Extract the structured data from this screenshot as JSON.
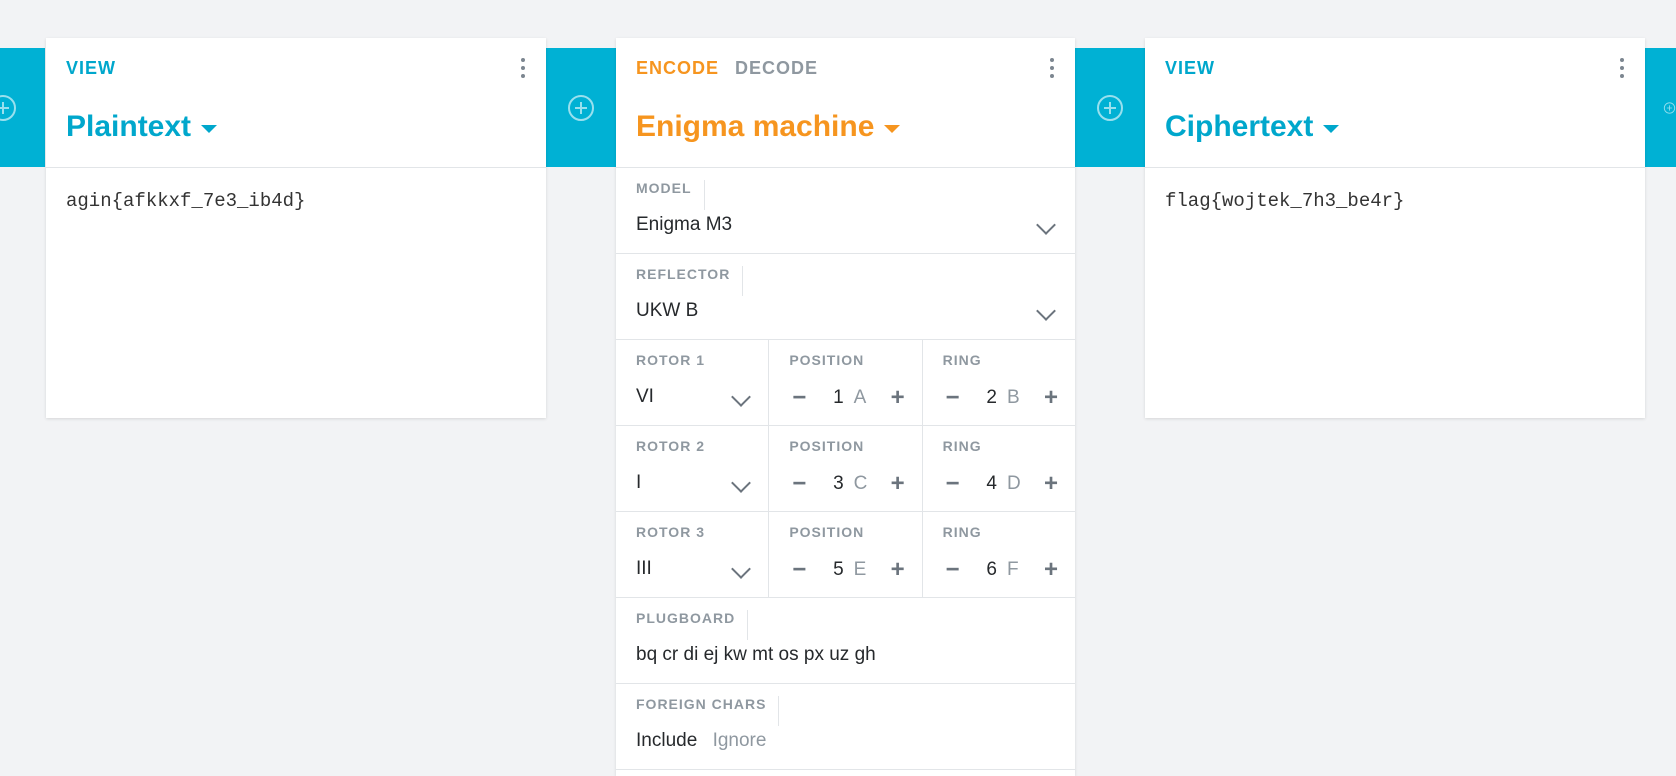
{
  "left_brick": {
    "tab": "VIEW",
    "title": "Plaintext",
    "content": "agin{afkkxf_7e3_ib4d}"
  },
  "enigma_brick": {
    "tabs": [
      "ENCODE",
      "DECODE"
    ],
    "title": "Enigma machine",
    "model": {
      "label": "MODEL",
      "value": "Enigma M3"
    },
    "reflector": {
      "label": "REFLECTOR",
      "value": "UKW B"
    },
    "rotors": [
      {
        "label": "ROTOR 1",
        "value": "VI",
        "position_label": "POSITION",
        "position": "1",
        "position_letter": "A",
        "ring_label": "RING",
        "ring": "2",
        "ring_letter": "B"
      },
      {
        "label": "ROTOR 2",
        "value": "I",
        "position_label": "POSITION",
        "position": "3",
        "position_letter": "C",
        "ring_label": "RING",
        "ring": "4",
        "ring_letter": "D"
      },
      {
        "label": "ROTOR 3",
        "value": "III",
        "position_label": "POSITION",
        "position": "5",
        "position_letter": "E",
        "ring_label": "RING",
        "ring": "6",
        "ring_letter": "F"
      }
    ],
    "plugboard": {
      "label": "PLUGBOARD",
      "value": "bq cr di ej kw mt os px uz gh"
    },
    "foreign_chars": {
      "label": "FOREIGN CHARS",
      "options": [
        "Include",
        "Ignore"
      ],
      "selected": "Include"
    }
  },
  "right_brick": {
    "tab": "VIEW",
    "title": "Ciphertext",
    "content": "flag{wojtek_7h3_be4r}"
  },
  "colors": {
    "accent_blue": "#00a7cc",
    "accent_orange": "#f6951f",
    "add_slot": "#00b1d4"
  },
  "icons": {
    "add": "plus-circle-icon",
    "menu": "more-vertical-icon",
    "dropdown": "chevron-down-icon"
  }
}
